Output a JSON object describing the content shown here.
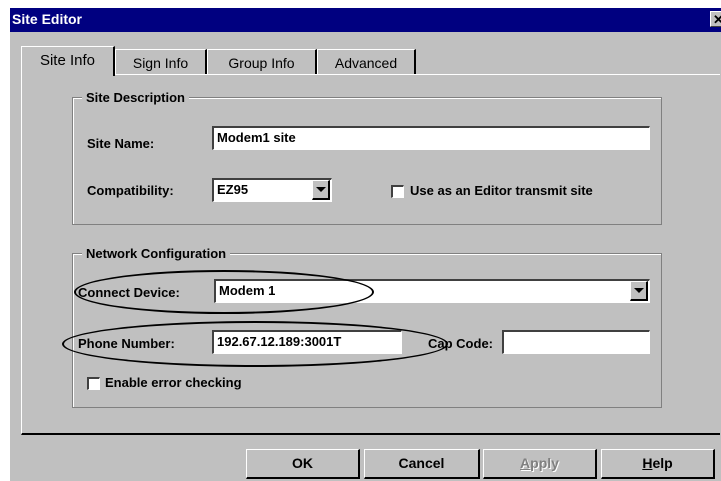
{
  "window": {
    "title": "Site Editor",
    "close_glyph": "✕"
  },
  "tabs": [
    {
      "label": "Site Info",
      "active": true
    },
    {
      "label": "Sign Info",
      "active": false
    },
    {
      "label": "Group Info",
      "active": false
    },
    {
      "label": "Advanced",
      "active": false
    }
  ],
  "site_description": {
    "group_title": "Site Description",
    "site_name_label": "Site Name:",
    "site_name_value": "Modem1 site",
    "compatibility_label": "Compatibility:",
    "compatibility_value": "EZ95",
    "editor_transmit_label": "Use as an Editor transmit site",
    "editor_transmit_checked": false
  },
  "network_configuration": {
    "group_title": "Network Configuration",
    "connect_device_label": "Connect Device:",
    "connect_device_value": "Modem 1",
    "phone_number_label": "Phone Number:",
    "phone_number_value": "192.67.12.189:3001T",
    "cap_code_label": "Cap Code:",
    "cap_code_value": "",
    "error_checking_label": "Enable error checking",
    "error_checking_checked": false
  },
  "buttons": {
    "ok": "OK",
    "cancel": "Cancel",
    "apply": "Apply",
    "help": "Help"
  },
  "colors": {
    "titlebar": "#000080",
    "face": "#c0c0c0",
    "annotation": "#000000"
  }
}
